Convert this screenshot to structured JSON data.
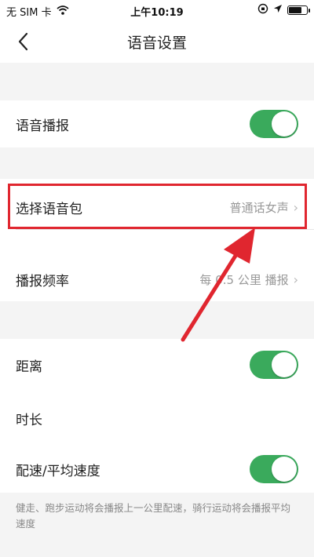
{
  "status_bar": {
    "carrier": "无 SIM 卡",
    "time": "上午10:19",
    "wifi_icon": "wifi-icon",
    "battery_level": 0.8
  },
  "nav": {
    "title": "语音设置",
    "back_icon": "chevron-left-icon"
  },
  "settings": {
    "voice_broadcast": {
      "label": "语音播报",
      "enabled": true
    },
    "voice_pack": {
      "label": "选择语音包",
      "value": "普通话女声"
    },
    "frequency": {
      "label": "播报频率",
      "value": "每 0.5 公里 播报"
    },
    "distance": {
      "label": "距离",
      "enabled": true
    },
    "duration": {
      "label": "时长"
    },
    "pace": {
      "label": "配速/平均速度",
      "enabled": true
    }
  },
  "footer_note": "健走、跑步运动将会播报上一公里配速，骑行运动将会播报平均速度",
  "colors": {
    "toggle_on": "#3aaa5c",
    "highlight": "#e0262f",
    "arrow": "#e0262f"
  }
}
